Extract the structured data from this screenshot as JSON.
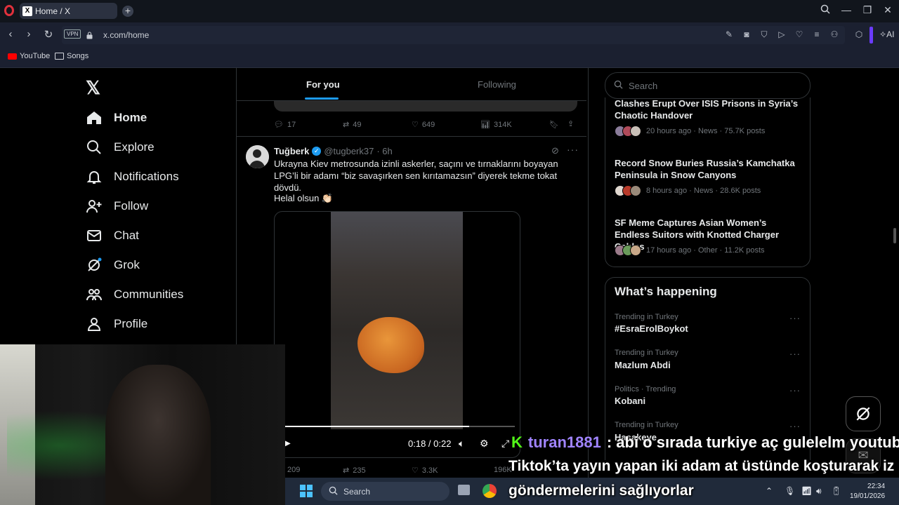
{
  "browser": {
    "tab_title": "Home / X",
    "tab_favicon": "X",
    "url": "x.com/home",
    "vpn_label": "VPN",
    "ai_label": "AI",
    "bookmarks": [
      {
        "label": "YouTube",
        "icon": "youtube-icon"
      },
      {
        "label": "Songs",
        "icon": "folder-icon"
      }
    ]
  },
  "sidebar": {
    "logo": "𝕏",
    "items": [
      {
        "label": "Home",
        "icon": "home-icon"
      },
      {
        "label": "Explore",
        "icon": "search-icon"
      },
      {
        "label": "Notifications",
        "icon": "bell-icon"
      },
      {
        "label": "Follow",
        "icon": "person-add-icon"
      },
      {
        "label": "Chat",
        "icon": "mail-icon"
      },
      {
        "label": "Grok",
        "icon": "grok-icon"
      },
      {
        "label": "Communities",
        "icon": "communities-icon"
      },
      {
        "label": "Profile",
        "icon": "person-icon"
      }
    ]
  },
  "feed": {
    "tabs": [
      "For you",
      "Following"
    ],
    "prev_tweet_actions": {
      "replies": "17",
      "reposts": "49",
      "likes": "649",
      "views": "314K"
    },
    "tweet": {
      "name": "Tuğberk",
      "handle": "@tugberk37",
      "time": "· 6h",
      "text": "Ukrayna Kiev metrosunda izinli askerler, saçını ve tırnaklarını boyayan LPG’li bir adamı “biz savaşırken sen kırıtamazsın” diyerek tekme tokat dövdü.",
      "text2": "Helal olsun 👏🏻",
      "video_time": "0:18 / 0:22",
      "video_progress": 0.8,
      "actions": {
        "replies": "209",
        "reposts": "235",
        "likes": "3.3K",
        "views": "196K"
      }
    }
  },
  "right": {
    "search_placeholder": "Search",
    "news": [
      {
        "title": "Clashes Erupt Over ISIS Prisons in Syria’s Chaotic Handover",
        "meta": "20 hours ago · News · 75.7K posts"
      },
      {
        "title": "Record Snow Buries Russia’s Kamchatka Peninsula in Snow Canyons",
        "meta": "8 hours ago · News · 28.6K posts"
      },
      {
        "title": "SF Meme Captures Asian Women’s Endless Suitors with Knotted Charger Cables",
        "meta": "17 hours ago · Other · 11.2K posts"
      }
    ],
    "happening_title": "What’s happening",
    "trends": [
      {
        "category": "Trending in Turkey",
        "name": "#EsraErolBoykot"
      },
      {
        "category": "Trending in Turkey",
        "name": "Mazlum Abdi"
      },
      {
        "category": "Politics · Trending",
        "name": "Kobani"
      },
      {
        "category": "Trending in Turkey",
        "name": "Hasakeye"
      }
    ]
  },
  "chat_overlay": {
    "platform_icon": "K",
    "username": "turan1881",
    "line1": ": abi o sırada turkiye aç gulelelm youtube",
    "line2": "Tiktok’ta yayın yapan iki adam at üstünde koşturarak iz",
    "line3": "göndermelerini sağlıyorlar"
  },
  "taskbar": {
    "search_label": "Search",
    "time": "22:34",
    "date": "19/01/2026"
  },
  "colors": {
    "accent": "#1d9bf0",
    "kick_green": "#53fc18",
    "chat_username": "#a084ff"
  }
}
